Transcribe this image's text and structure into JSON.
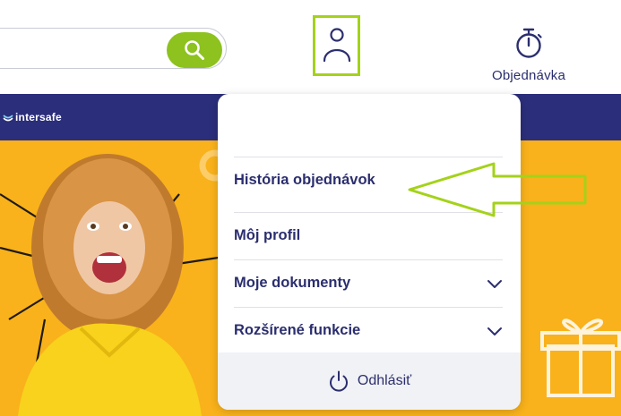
{
  "header": {
    "search": {
      "value": "",
      "placeholder": ""
    },
    "order": {
      "label": "Objednávka"
    }
  },
  "brand": {
    "logo_text": "intersafe"
  },
  "menu": {
    "items": [
      {
        "label": "História objednávok",
        "has_chevron": false
      },
      {
        "label": "Môj profil",
        "has_chevron": false
      },
      {
        "label": "Moje dokumenty",
        "has_chevron": true
      },
      {
        "label": "Rozšírené funkcie",
        "has_chevron": true
      }
    ],
    "logout_label": "Odhlásiť"
  },
  "colors": {
    "accent_green": "#8dc21f",
    "highlight_green": "#a4d21a",
    "navy": "#2b2e7a",
    "hero_yellow": "#f9b21b"
  }
}
